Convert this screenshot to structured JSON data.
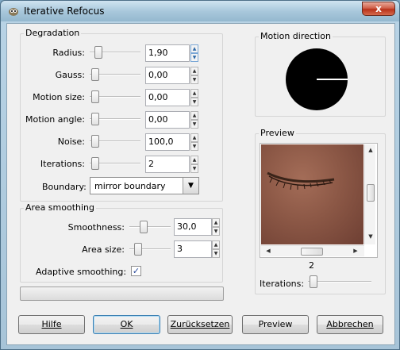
{
  "window": {
    "title": "Iterative Refocus",
    "close_glyph": "x"
  },
  "degradation": {
    "legend": "Degradation",
    "rows": [
      {
        "label": "Radius:",
        "value": "1,90"
      },
      {
        "label": "Gauss:",
        "value": "0,00"
      },
      {
        "label": "Motion size:",
        "value": "0,00"
      },
      {
        "label": "Motion angle:",
        "value": "0,00"
      },
      {
        "label": "Noise:",
        "value": "100,0"
      },
      {
        "label": "Iterations:",
        "value": "2"
      }
    ],
    "boundary_label": "Boundary:",
    "boundary_value": "mirror boundary"
  },
  "area_smoothing": {
    "legend": "Area smoothing",
    "smoothness_label": "Smoothness:",
    "smoothness_value": "30,0",
    "area_size_label": "Area size:",
    "area_size_value": "3",
    "adaptive_label": "Adaptive smoothing:",
    "adaptive_checked": true
  },
  "motion_direction": {
    "legend": "Motion direction"
  },
  "preview": {
    "legend": "Preview",
    "iterations_value": "2",
    "iterations_label": "Iterations:"
  },
  "buttons": {
    "help": "Hilfe",
    "ok": "OK",
    "reset": "Zurücksetzen",
    "preview": "Preview",
    "cancel": "Abbrechen"
  },
  "icons": {
    "app": "gimp-icon",
    "combo_arrow": "chevron-down-icon",
    "check": "checkmark-icon"
  }
}
